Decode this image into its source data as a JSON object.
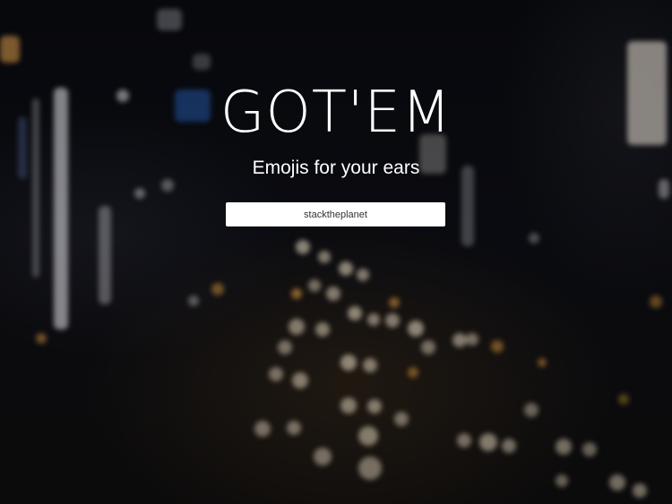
{
  "hero": {
    "title": "GOT'EM",
    "subtitle": "Emojis for your ears",
    "input_value": "stacktheplanet"
  },
  "background": {
    "description_icon": "blurred-city-night-traffic-image",
    "accent_light": "#f4e6c4",
    "accent_warm": "#e8a040"
  }
}
